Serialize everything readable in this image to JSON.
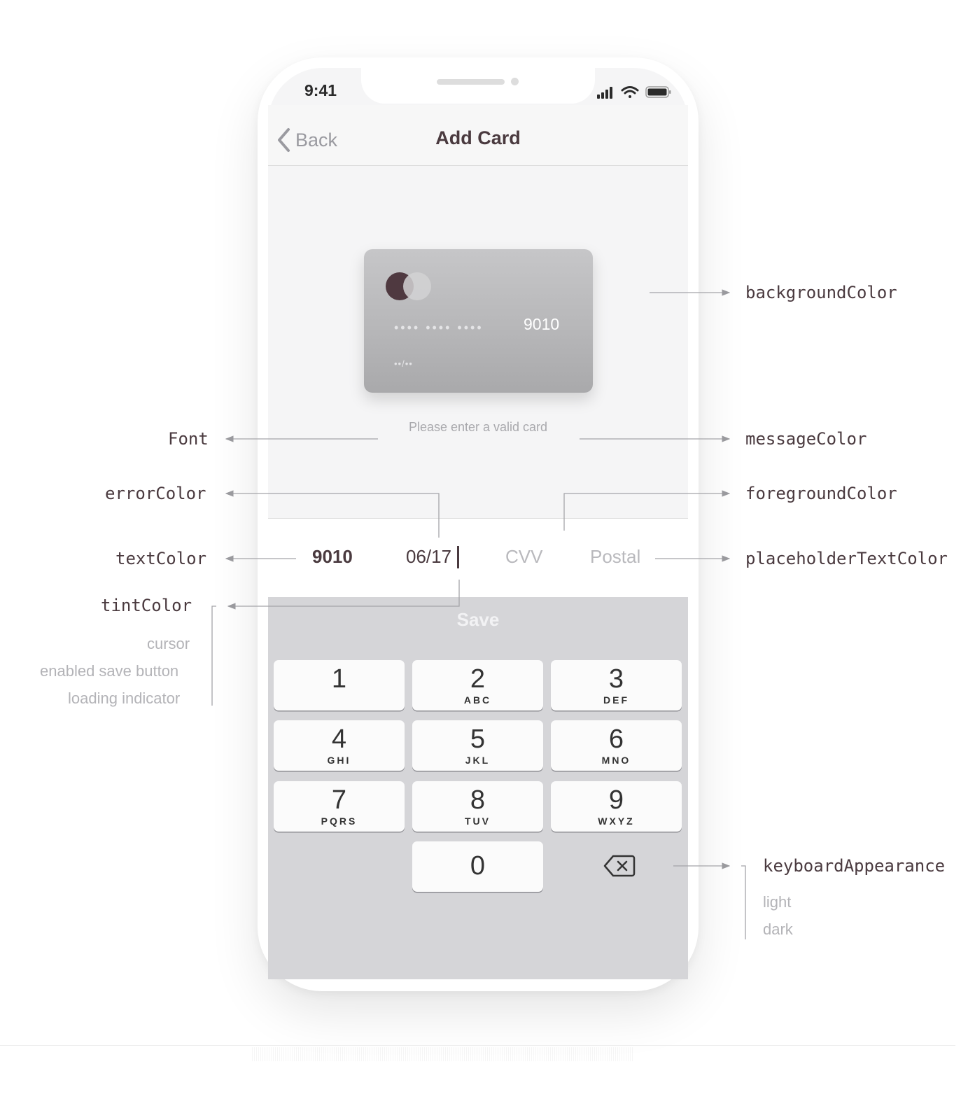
{
  "status_bar": {
    "time": "9:41"
  },
  "nav": {
    "back_label": "Back",
    "title": "Add Card"
  },
  "card": {
    "masked_groups": "•••• •••• ••••",
    "last4": "9010",
    "expiry_masked": "••/••"
  },
  "message": "Please enter a valid card",
  "fields": {
    "number": "9010",
    "expiry": "06/17",
    "cvv_placeholder": "CVV",
    "postal_placeholder": "Postal"
  },
  "save_label": "Save",
  "keypad": [
    {
      "num": "1",
      "letters": ""
    },
    {
      "num": "2",
      "letters": "ABC"
    },
    {
      "num": "3",
      "letters": "DEF"
    },
    {
      "num": "4",
      "letters": "GHI"
    },
    {
      "num": "5",
      "letters": "JKL"
    },
    {
      "num": "6",
      "letters": "MNO"
    },
    {
      "num": "7",
      "letters": "PQRS"
    },
    {
      "num": "8",
      "letters": "TUV"
    },
    {
      "num": "9",
      "letters": "WXYZ"
    },
    {
      "num": "0",
      "letters": ""
    }
  ],
  "annotations": {
    "backgroundColor": "backgroundColor",
    "font": "Font",
    "messageColor": "messageColor",
    "errorColor": "errorColor",
    "foregroundColor": "foregroundColor",
    "textColor": "textColor",
    "placeholderTextColor": "placeholderTextColor",
    "tintColor": "tintColor",
    "tint_items": [
      "cursor",
      "enabled save button",
      "loading indicator"
    ],
    "keyboardAppearance": "keyboardAppearance",
    "keyboard_items": [
      "light",
      "dark"
    ]
  },
  "colors": {
    "accent": "#4a3a3f",
    "placeholder": "#b9b9bd",
    "keyboard_bg": "#d5d5d8",
    "card_logo": "#4f3940"
  },
  "icons": [
    "chevron-left-icon",
    "signal-icon",
    "wifi-icon",
    "battery-icon",
    "delete-icon"
  ]
}
